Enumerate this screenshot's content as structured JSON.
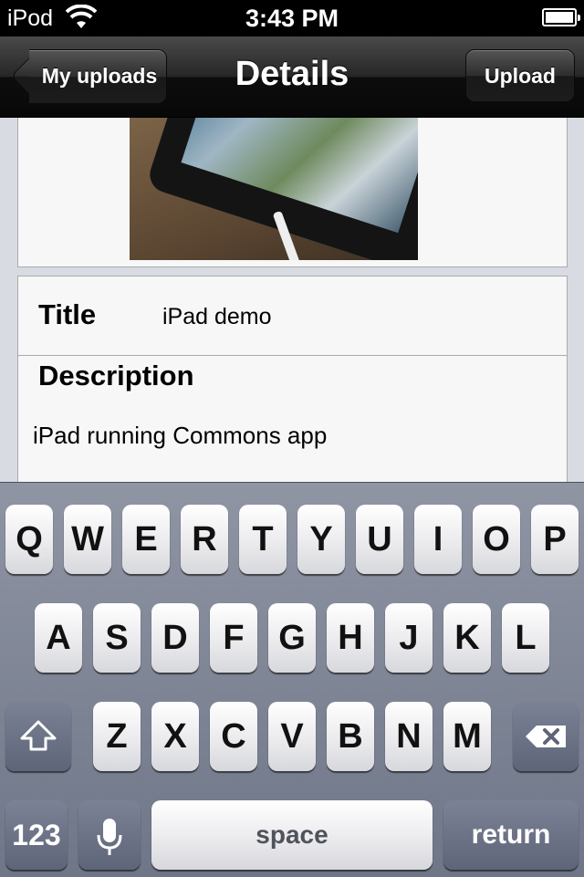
{
  "status_bar": {
    "carrier": "iPod",
    "time": "3:43 PM"
  },
  "nav": {
    "back_label": "My uploads",
    "title": "Details",
    "upload_label": "Upload"
  },
  "details": {
    "title_label": "Title",
    "title_value": "iPad demo",
    "description_label": "Description",
    "description_value": "iPad running Commons app"
  },
  "keyboard": {
    "row1": [
      "Q",
      "W",
      "E",
      "R",
      "T",
      "Y",
      "U",
      "I",
      "O",
      "P"
    ],
    "row2": [
      "A",
      "S",
      "D",
      "F",
      "G",
      "H",
      "J",
      "K",
      "L"
    ],
    "row3": [
      "Z",
      "X",
      "C",
      "V",
      "B",
      "N",
      "M"
    ],
    "numbers_label": "123",
    "space_label": "space",
    "return_label": "return"
  },
  "icons": [
    "wifi-icon",
    "battery-icon",
    "image-thumbnail",
    "shift-icon",
    "delete-icon",
    "microphone-icon"
  ]
}
